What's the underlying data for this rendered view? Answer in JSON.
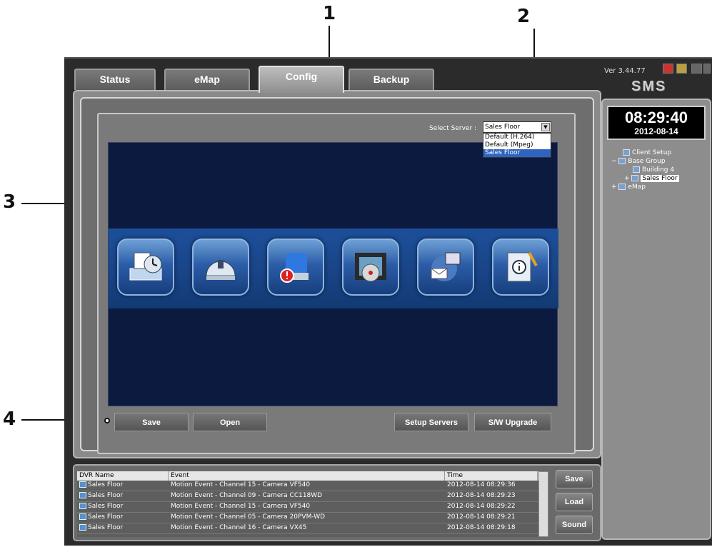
{
  "callouts": [
    "1",
    "2",
    "3",
    "4"
  ],
  "tabs": [
    "Status",
    "eMap",
    "Config",
    "Backup"
  ],
  "active_tab": "Config",
  "server": {
    "label": "Select Server :",
    "selected": "Sales Floor",
    "options": [
      "Default (H.264)",
      "Default (Mpeg)",
      "Sales Floor"
    ]
  },
  "config_icons": [
    "schedule-icon",
    "camera-dome-icon",
    "alarm-siren-icon",
    "film-reel-icon",
    "email-network-icon",
    "info-notebook-icon"
  ],
  "buttons": {
    "save": "Save",
    "open": "Open",
    "setup_servers": "Setup Servers",
    "sw_upgrade": "S/W Upgrade"
  },
  "app": {
    "version": "Ver 3.44.77",
    "brand": "SMS",
    "clock_time": "08:29:40",
    "clock_date": "2012-08-14"
  },
  "tree": [
    "Client Setup",
    "Base Group",
    "Building 4",
    "Sales Floor",
    "eMap"
  ],
  "log": {
    "headers": [
      "DVR Name",
      "Event",
      "Time"
    ],
    "rows": [
      {
        "dvr": "Sales Floor",
        "event": "Motion Event  -  Channel 15  -  Camera VF540",
        "time": "2012-08-14 08:29:36"
      },
      {
        "dvr": "Sales Floor",
        "event": "Motion Event  -  Channel 09  -  Camera CC118WD",
        "time": "2012-08-14 08:29:23"
      },
      {
        "dvr": "Sales Floor",
        "event": "Motion Event  -  Channel 15  -  Camera VF540",
        "time": "2012-08-14 08:29:22"
      },
      {
        "dvr": "Sales Floor",
        "event": "Motion Event  -  Channel 05  -  Camera 20PVM-WD",
        "time": "2012-08-14 08:29:21"
      },
      {
        "dvr": "Sales Floor",
        "event": "Motion Event  -  Channel 16  -  Camera VX45",
        "time": "2012-08-14 08:29:18"
      }
    ],
    "buttons": [
      "Save",
      "Load",
      "Sound"
    ]
  },
  "colors": {
    "accent": "#2e64c0",
    "warning": "#f5e600"
  }
}
